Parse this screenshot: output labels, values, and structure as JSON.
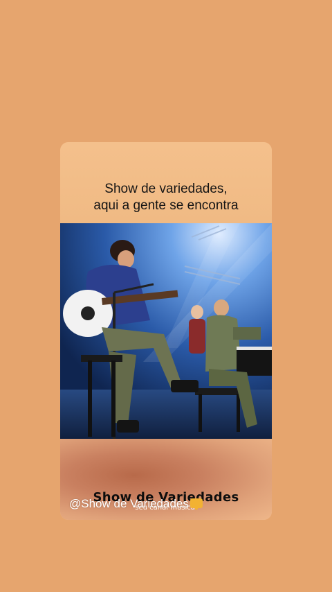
{
  "post": {
    "caption_line1": "Show de variedades,",
    "caption_line2": "aqui a gente se encontra",
    "brand_title": "Show de Variedades",
    "brand_subtitle": "seu canal musical",
    "handle": "@Show de Variedades"
  },
  "photo": {
    "icon": "concert-photo",
    "description_icon_name": "concert-stage-image"
  },
  "colors": {
    "background": "#E6A56E",
    "card_top": "#F4C08C",
    "stage_blue": "#1A3E7A",
    "text_dark": "#141414",
    "text_light": "#FFFFFF"
  }
}
